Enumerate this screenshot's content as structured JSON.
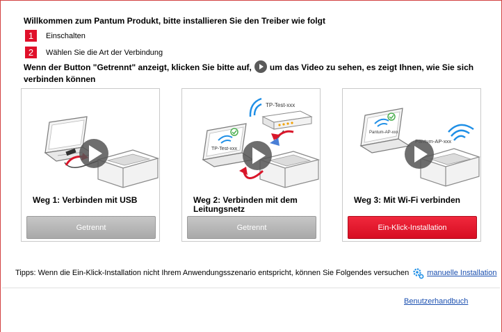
{
  "welcome": "Willkommen zum Pantum Produkt, bitte installieren Sie den Treiber wie folgt",
  "steps": [
    {
      "num": "1",
      "text": "Einschalten"
    },
    {
      "num": "2",
      "text": "Wählen Sie die Art der Verbindung"
    }
  ],
  "instruction": {
    "before": "Wenn der Button \"Getrennt\" anzeigt, klicken Sie bitte auf,",
    "after": "um das Video zu sehen, es zeigt Ihnen, wie Sie sich verbinden können"
  },
  "cards": [
    {
      "title": "Weg 1: Verbinden mit USB",
      "button": "Getrennt"
    },
    {
      "title": "Weg 2: Verbinden mit dem Leitungsnetz",
      "button": "Getrennt",
      "router_label": "TP-Test-xxx",
      "screen_label": "TP-Test-xxx"
    },
    {
      "title": "Weg 3: Mit Wi-Fi verbinden",
      "button": "Ein-Klick-Installation",
      "printer_label": "Pantum-AP-xxx",
      "screen_label": "Pantum-AP-xxx"
    }
  ],
  "tips": {
    "text": "Tipps: Wenn die Ein-Klick-Installation nicht Ihrem Anwendungsszenario entspricht, können Sie Folgendes versuchen",
    "link": "manuelle Installation"
  },
  "footer": {
    "handbook": "Benutzerhandbuch"
  },
  "colors": {
    "accent": "#e0102a",
    "link": "#1a4fb0",
    "wifi": "#1f8fe6",
    "check": "#4caf50"
  }
}
